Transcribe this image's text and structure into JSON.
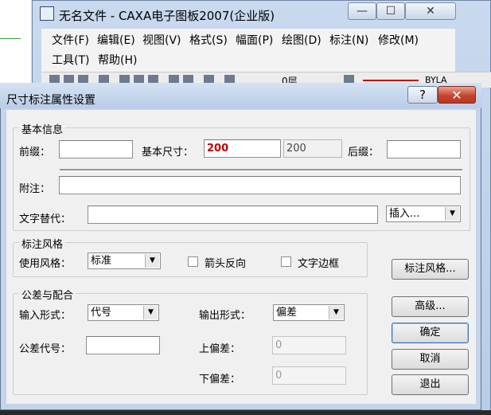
{
  "main_window": {
    "title": "无名文件 - CAXA电子图板2007(企业版)",
    "window_buttons": {
      "minimize": "—",
      "maximize": "☐",
      "close": "✕"
    },
    "menu": [
      "文件(F)",
      "编辑(E)",
      "视图(V)",
      "格式(S)",
      "幅面(P)",
      "绘图(D)",
      "标注(N)",
      "修改(M)",
      "工具(T)",
      "帮助(H)"
    ],
    "toolbar": {
      "layer_field": "0层",
      "linetype_text": "BYLA"
    }
  },
  "dialog": {
    "title": "尺寸标注属性设置",
    "help_glyph": "?",
    "close_glyph": "✕",
    "basic_info": {
      "legend": "基本信息",
      "prefix_label": "前缀：",
      "prefix_value": "",
      "base_dimension_label": "基本尺寸：",
      "base_dimension_value": "200",
      "base_dimension_measured": "200",
      "suffix_label": "后缀：",
      "suffix_value": "",
      "note_label": "附注：",
      "note_value": "",
      "text_replace_label": "文字替代：",
      "text_replace_value": "",
      "insert_label": "插入..."
    },
    "style_group": {
      "legend": "标注风格",
      "use_style_label": "使用风格：",
      "use_style_value": "标准",
      "arrow_reverse_label": "箭头反向",
      "arrow_reverse_checked": false,
      "text_border_label": "文字边框",
      "text_border_checked": false
    },
    "tolerance_group": {
      "legend": "公差与配合",
      "input_form_label": "输入形式：",
      "input_form_value": "代号",
      "output_form_label": "输出形式：",
      "output_form_value": "偏差",
      "tolerance_code_label": "公差代号：",
      "tolerance_code_value": "",
      "upper_dev_label": "上偏差：",
      "upper_dev_value": "0",
      "lower_dev_label": "下偏差：",
      "lower_dev_value": "0"
    },
    "buttons": {
      "style": "标注风格...",
      "advanced": "高级...",
      "ok": "确定",
      "cancel": "取消",
      "exit": "退出"
    }
  }
}
